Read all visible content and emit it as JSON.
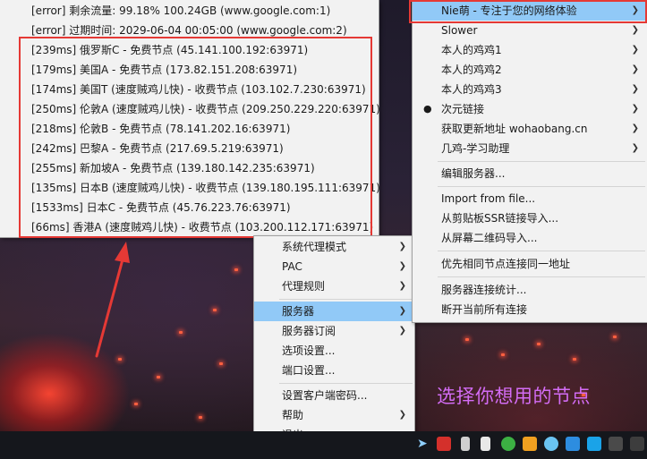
{
  "server_list": [
    {
      "label": "[error] 剩余流量: 99.18% 100.24GB (www.google.com:1)"
    },
    {
      "label": "[error] 过期时间: 2029-06-04 00:05:00 (www.google.com:2)"
    },
    {
      "label": "[239ms] 俄罗斯C - 免费节点 (45.141.100.192:63971)"
    },
    {
      "label": "[179ms] 美国A - 免费节点 (173.82.151.208:63971)"
    },
    {
      "label": "[174ms] 美国T (速度贼鸡儿快) - 收费节点 (103.102.7.230:63971)"
    },
    {
      "label": "[250ms] 伦敦A (速度贼鸡儿快) - 收费节点 (209.250.229.220:63971)"
    },
    {
      "label": "[218ms] 伦敦B - 免费节点 (78.141.202.16:63971)"
    },
    {
      "label": "[242ms] 巴黎A - 免费节点 (217.69.5.219:63971)"
    },
    {
      "label": "[255ms] 新加坡A - 免费节点 (139.180.142.235:63971)"
    },
    {
      "label": "[135ms] 日本B (速度贼鸡儿快) - 收费节点 (139.180.195.111:63971)"
    },
    {
      "label": "[1533ms] 日本C - 免费节点 (45.76.223.76:63971)"
    },
    {
      "label": "[66ms] 香港A (速度贼鸡儿快) - 收费节点 (103.200.112.171:63971)"
    }
  ],
  "main_menu": {
    "proxy_mode": "系统代理模式",
    "pac": "PAC",
    "proxy_rules": "代理规则",
    "servers": "服务器",
    "server_subscription": "服务器订阅",
    "options": "选项设置...",
    "port_settings": "端口设置...",
    "client_password": "设置客户端密码...",
    "help": "帮助",
    "exit": "退出"
  },
  "sub_menu": {
    "group_nie": "Nie萌 - 专注于您的网络体验",
    "group_slower": "Slower",
    "group_1": "本人的鸡鸡1",
    "group_2": "本人的鸡鸡2",
    "group_3": "本人的鸡鸡3",
    "group_ciyuan": "次元链接",
    "group_ciyuan_mark": "●",
    "group_wohaobang": "获取更新地址 wohaobang.cn",
    "group_jiwei": "几鸡-学习助理",
    "edit_servers": "编辑服务器...",
    "import_file": "Import from file...",
    "import_clipboard": "从剪贴板SSR链接导入...",
    "import_qr": "从屏幕二维码导入...",
    "prefer_same_node": "优先相同节点连接同一地址",
    "conn_stats": "服务器连接统计...",
    "disconnect_all": "断开当前所有连接"
  },
  "caption": "选择你想用的节点",
  "colors": {
    "highlight_box": "#e53935",
    "caption": "#d36cf5",
    "selected_item": "#91c9f7"
  }
}
